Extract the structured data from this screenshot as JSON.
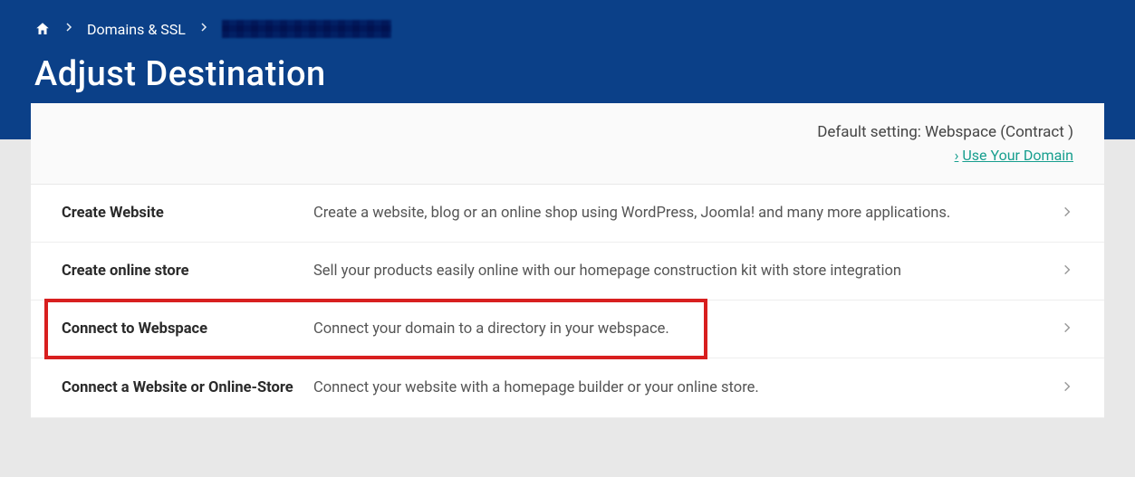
{
  "breadcrumb": {
    "domains_ssl": "Domains & SSL"
  },
  "page_title": "Adjust Destination",
  "info": {
    "default_setting": "Default setting: Webspace (Contract )",
    "use_domain": "Use Your Domain"
  },
  "rows": {
    "create_website": {
      "title": "Create Website",
      "desc": "Create a website, blog or an online shop using WordPress, Joomla! and many more applications."
    },
    "create_store": {
      "title": "Create online store",
      "desc": "Sell your products easily online with our homepage construction kit with store integration"
    },
    "connect_webspace": {
      "title": "Connect to Webspace",
      "desc": "Connect your domain to a directory in your webspace."
    },
    "connect_site": {
      "title": "Connect a Website or Online-Store",
      "desc": "Connect your website with a homepage builder or your online store."
    }
  }
}
